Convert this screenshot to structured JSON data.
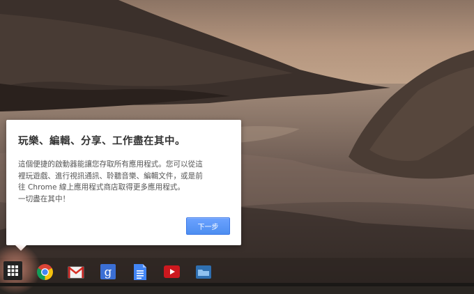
{
  "dialog": {
    "title": "玩樂、編輯、分享、工作盡在其中。",
    "body_lines": [
      "這個便捷的啟動器能讓您存取所有應用程式。您可以從這",
      "裡玩遊戲、進行視訊通訊、聆聽音樂、編輯文件，或是前",
      "往 Chrome 線上應用程式商店取得更多應用程式。",
      "一切盡在其中！"
    ],
    "next_button_label": "下一步"
  },
  "shelf": {
    "items": [
      {
        "name": "app-launcher",
        "icon": "app-launcher-grid-icon"
      },
      {
        "name": "chrome",
        "icon": "chrome-icon"
      },
      {
        "name": "gmail",
        "icon": "gmail-icon"
      },
      {
        "name": "google-search",
        "icon": "google-search-icon",
        "glyph": "g"
      },
      {
        "name": "google-docs",
        "icon": "google-docs-icon"
      },
      {
        "name": "youtube",
        "icon": "youtube-icon"
      },
      {
        "name": "files",
        "icon": "files-folder-icon"
      }
    ]
  },
  "colors": {
    "accent_button": "#4d8ef0",
    "dialog_background": "#ffffff"
  }
}
